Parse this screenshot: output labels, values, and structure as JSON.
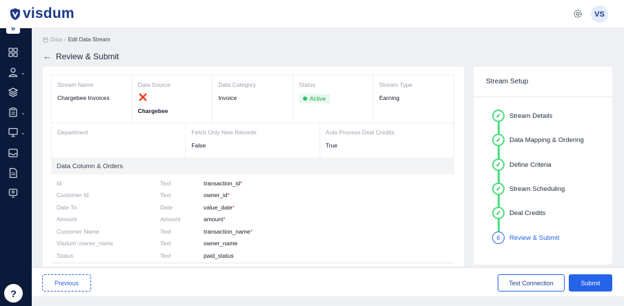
{
  "app": {
    "name": "visdum",
    "avatar_initials": "VS"
  },
  "breadcrumb": {
    "root": "Data",
    "current": "Edit Data Stream"
  },
  "page": {
    "title": "Review & Submit"
  },
  "stream_info": {
    "row1": [
      {
        "label": "Stream Name",
        "value": "Chargebee Invoices"
      },
      {
        "label": "Data Source",
        "value": "Chargebee"
      },
      {
        "label": "Data Category",
        "value": "Invoice"
      },
      {
        "label": "Status",
        "value": "Active"
      },
      {
        "label": "Stream Type",
        "value": "Earning"
      }
    ],
    "row2": [
      {
        "label": "Department",
        "value": ""
      },
      {
        "label": "Fetch Only New Records",
        "value": "False"
      },
      {
        "label": "Auto Process Deal Credits",
        "value": "True"
      }
    ]
  },
  "columns_section": {
    "title": "Data Column & Orders",
    "rows": [
      {
        "name": "Id",
        "type": "Text",
        "mapped": "transaction_id",
        "required": "*"
      },
      {
        "name": "Customer Id",
        "type": "Text",
        "mapped": "owner_id",
        "required": "*"
      },
      {
        "name": "Date To",
        "type": "Date",
        "mapped": "value_date",
        "required": "*"
      },
      {
        "name": "Amount",
        "type": "Amount",
        "mapped": "amount",
        "required": "*"
      },
      {
        "name": "Customer Name",
        "type": "Text",
        "mapped": "transaction_name",
        "required": "*"
      },
      {
        "name": "Visdum::owner_name",
        "type": "Text",
        "mapped": "owner_name",
        "required": ""
      },
      {
        "name": "Status",
        "type": "Text",
        "mapped": "paid_status",
        "required": ""
      }
    ]
  },
  "setup": {
    "title": "Stream Setup",
    "steps": [
      {
        "label": "Stream Details",
        "state": "done"
      },
      {
        "label": "Data Mapping & Ordering",
        "state": "done"
      },
      {
        "label": "Define Criteria",
        "state": "done"
      },
      {
        "label": "Stream Scheduling",
        "state": "done"
      },
      {
        "label": "Deal Credits",
        "state": "done"
      },
      {
        "label": "Review & Submit",
        "state": "current",
        "number": "6"
      }
    ]
  },
  "footer": {
    "previous": "Previous",
    "test_connection": "Test Connection",
    "submit": "Submit"
  },
  "sidebar": {
    "help": "?"
  },
  "colors": {
    "primary": "#2563eb",
    "sidebar": "#0b1a3a",
    "success": "#22c55e",
    "brand_source": "#ef4423"
  }
}
